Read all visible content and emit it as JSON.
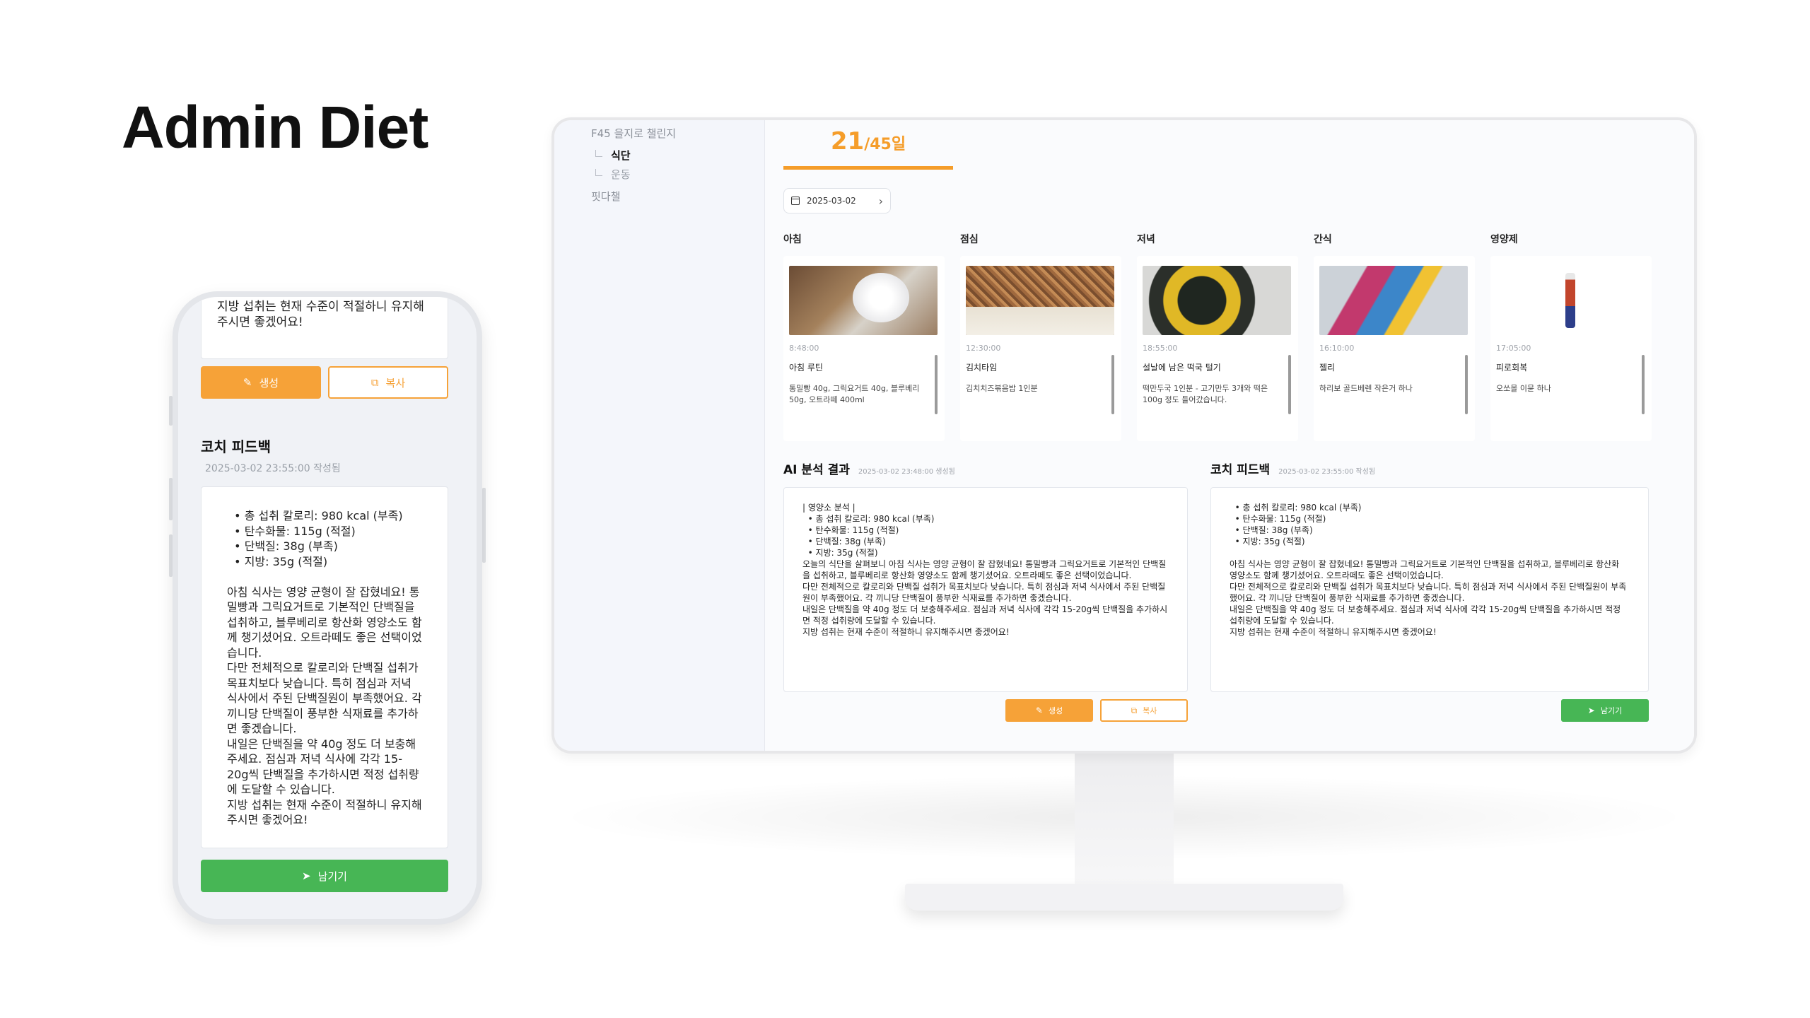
{
  "page": {
    "title": "Admin Diet"
  },
  "sidebar": {
    "group1": "F45 을지로 챌린지",
    "sub_active": "식단",
    "sub_other": "운동",
    "group2": "핏다챌"
  },
  "progress": {
    "current": "21",
    "total": "/45일"
  },
  "date_picker": {
    "value": "2025-03-02",
    "next_icon": "chevron-right-icon"
  },
  "meals": [
    {
      "label": "아침",
      "time": "8:48:00",
      "name": "아침 루틴",
      "desc": "통밀빵 40g, 그릭요거트 40g, 블루베리 50g, 오트라떼 400ml"
    },
    {
      "label": "점심",
      "time": "12:30:00",
      "name": "김치타임",
      "desc": "김치치즈볶음밥 1인분"
    },
    {
      "label": "저녁",
      "time": "18:55:00",
      "name": "설날에 남은 떡국 털기",
      "desc": "떡만두국 1인분 - 고기만두 3개와 떡은 100g 정도 들어갔습니다."
    },
    {
      "label": "간식",
      "time": "16:10:00",
      "name": "젤리",
      "desc": "하리보 골드베렌 작은거 하나"
    },
    {
      "label": "영양제",
      "time": "17:05:00",
      "name": "피로회복",
      "desc": "오쏘몰 이뮨 하나"
    }
  ],
  "ai": {
    "title": "AI 분석 결과",
    "time": "2025-03-02 23:48:00 생성됨",
    "text": "| 영양소 분석 |\n  • 총 섭취 칼로리: 980 kcal (부족)\n  • 탄수화물: 115g (적절)\n  • 단백질: 38g (부족)\n  • 지방: 35g (적절)\n오늘의 식단을 살펴보니 아침 식사는 영양 균형이 잘 잡혔네요! 통밀빵과 그릭요거트로 기본적인 단백질을 섭취하고, 블루베리로 항산화 영양소도 함께 챙기셨어요. 오트라떼도 좋은 선택이었습니다.\n다만 전체적으로 칼로리와 단백질 섭취가 목표치보다 낮습니다. 특히 점심과 저녁 식사에서 주된 단백질원이 부족했어요. 각 끼니당 단백질이 풍부한 식재료를 추가하면 좋겠습니다.\n내일은 단백질을 약 40g 정도 더 보충해주세요. 점심과 저녁 식사에 각각 15-20g씩 단백질을 추가하시면 적정 섭취량에 도달할 수 있습니다.\n지방 섭취는 현재 수준이 적절하니 유지해주시면 좋겠어요!",
    "generate_label": "생성",
    "copy_label": "복사"
  },
  "coach": {
    "title": "코치 피드백",
    "time": "2025-03-02 23:55:00 작성됨",
    "text": "  • 총 섭취 칼로리: 980 kcal (부족)\n  • 탄수화물: 115g (적절)\n  • 단백질: 38g (부족)\n  • 지방: 35g (적절)\n\n아침 식사는 영양 균형이 잘 잡혔네요! 통밀빵과 그릭요거트로 기본적인 단백질을 섭취하고, 블루베리로 항산화 영양소도 함께 챙기셨어요. 오트라떼도 좋은 선택이었습니다.\n다만 전체적으로 칼로리와 단백질 섭취가 목표치보다 낮습니다. 특히 점심과 저녁 식사에서 주된 단백질원이 부족했어요. 각 끼니당 단백질이 풍부한 식재료를 추가하면 좋겠습니다.\n내일은 단백질을 약 40g 정도 더 보충해주세요. 점심과 저녁 식사에 각각 15-20g씩 단백질을 추가하시면 적정 섭취량에 도달할 수 있습니다.\n지방 섭취는 현재 수준이 적절하니 유지해주시면 좋겠어요!",
    "send_label": "남기기"
  },
  "phone": {
    "top_text": "지방 섭취는 현재 수준이 적절하니 유지해주시면 좋겠어요!",
    "generate_label": "생성",
    "copy_label": "복사",
    "coach_title": "코치 피드백",
    "coach_time": "2025-03-02 23:55:00 작성됨",
    "coach_text": "  • 총 섭취 칼로리: 980 kcal (부족)\n  • 탄수화물: 115g (적절)\n  • 단백질: 38g (부족)\n  • 지방: 35g (적절)\n\n아침 식사는 영양 균형이 잘 잡혔네요! 통밀빵과 그릭요거트로 기본적인 단백질을 섭취하고, 블루베리로 항산화 영양소도 함께 챙기셨어요. 오트라떼도 좋은 선택이었습니다.\n다만 전체적으로 칼로리와 단백질 섭취가 목표치보다 낮습니다. 특히 점심과 저녁 식사에서 주된 단백질원이 부족했어요. 각 끼니당 단백질이 풍부한 식재료를 추가하면 좋겠습니다.\n내일은 단백질을 약 40g 정도 더 보충해주세요. 점심과 저녁 식사에 각각 15-20g씩 단백질을 추가하시면 적정 섭취량에 도달할 수 있습니다.\n지방 섭취는 현재 수준이 적절하니 유지해주시면 좋겠어요!",
    "send_label": "남기기"
  },
  "colors": {
    "accent_orange": "#f6a238",
    "accent_green": "#47b655"
  }
}
